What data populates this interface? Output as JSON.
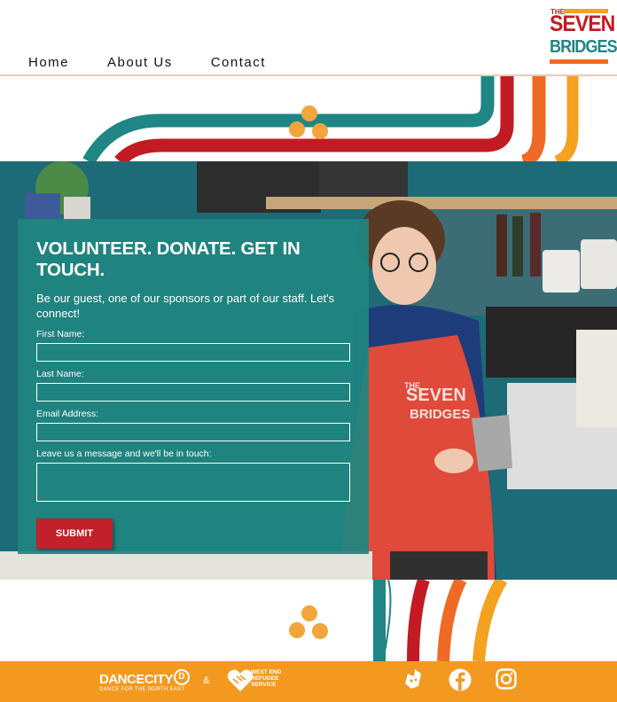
{
  "nav": {
    "items": [
      "Home",
      "About Us",
      "Contact"
    ]
  },
  "logo": {
    "the": "THE",
    "seven": "SEVEN",
    "bridges": "BRIDGES"
  },
  "form": {
    "title": "VOLUNTEER. DONATE. GET IN TOUCH.",
    "subtitle": "Be our guest, one of our sponsors or part of our staff. Let's connect!",
    "first_name_label": "First Name:",
    "last_name_label": "Last Name:",
    "email_label": "Email Address:",
    "message_label": "Leave us a message and we'll be in touch:",
    "submit_label": "SUBMIT"
  },
  "photo": {
    "apron_text_1": "THE",
    "apron_text_2": "SEVEN",
    "apron_text_3": "BRIDGES"
  },
  "footer": {
    "partner1_name": "DANCECITY",
    "partner1_tagline": "DANCE FOR THE NORTH EAST",
    "partner1_mark": "D",
    "amp": "&",
    "partner2_line1": "WEST END",
    "partner2_line2": "REFUGEE",
    "partner2_line3": "SERVICE",
    "social_icons": [
      "deliveroo-icon",
      "facebook-icon",
      "instagram-icon"
    ]
  },
  "colors": {
    "teal": "#1f8585",
    "red": "#c21b24",
    "orange": "#ef6a24",
    "amber": "#f4a21f",
    "footer": "#f4991f"
  }
}
